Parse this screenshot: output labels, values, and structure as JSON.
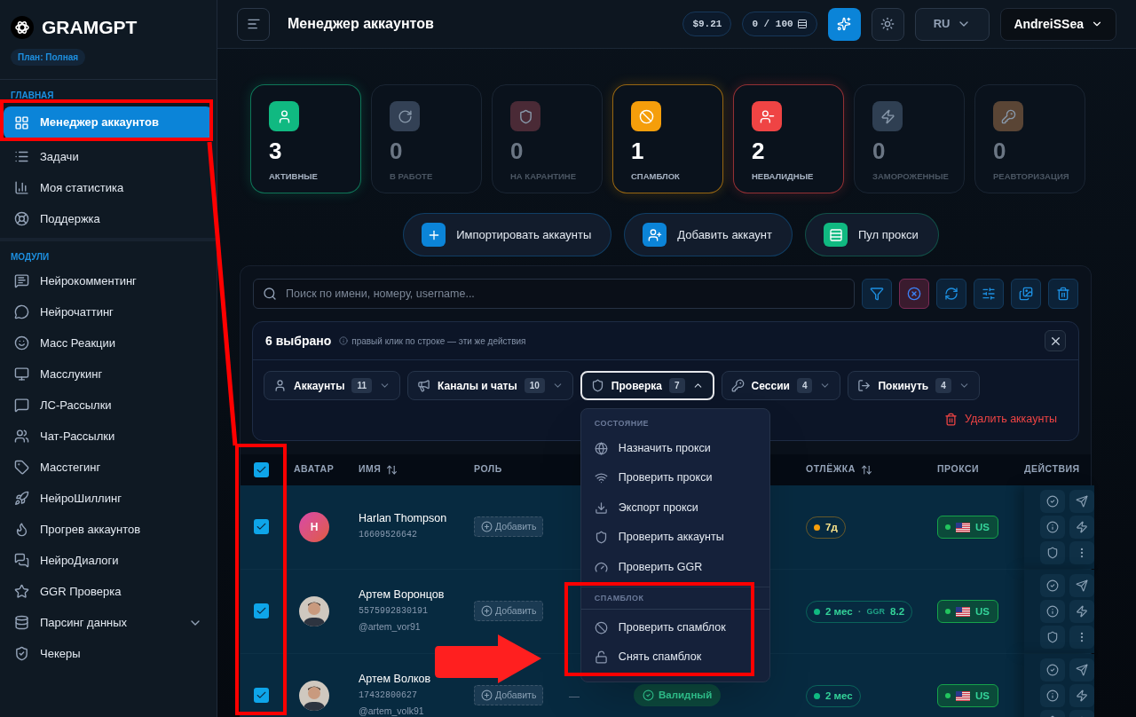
{
  "sidebar": {
    "brand": "GRAMGPT",
    "plan": "План: Полная",
    "sections": [
      {
        "title": "ГЛАВНАЯ",
        "items": [
          {
            "label": "Менеджер аккаунтов",
            "selected": true
          },
          {
            "label": "Задачи",
            "selected": false
          },
          {
            "label": "Моя статистика",
            "selected": false
          },
          {
            "label": "Поддержка",
            "selected": false
          }
        ]
      },
      {
        "title": "МОДУЛИ",
        "items": [
          {
            "label": "Нейрокомментинг",
            "selected": false
          },
          {
            "label": "Нейрочаттинг",
            "selected": false
          },
          {
            "label": "Масс Реакции",
            "selected": false
          },
          {
            "label": "Масслукинг",
            "selected": false
          },
          {
            "label": "ЛС-Рассылки",
            "selected": false
          },
          {
            "label": "Чат-Рассылки",
            "selected": false
          },
          {
            "label": "Масстегинг",
            "selected": false
          },
          {
            "label": "НейроШиллинг",
            "selected": false
          },
          {
            "label": "Прогрев аккаунтов",
            "selected": false
          },
          {
            "label": "НейроДиалоги",
            "selected": false
          },
          {
            "label": "GGR Проверка",
            "selected": false
          },
          {
            "label": "Парсинг данных",
            "selected": false,
            "expanded": false
          },
          {
            "label": "Чекеры",
            "selected": false
          }
        ]
      }
    ]
  },
  "header": {
    "title": "Менеджер аккаунтов",
    "balance": "$9.21",
    "quota": "0 / 100",
    "language": "RU",
    "user": "AndreiSSea"
  },
  "stats": [
    {
      "value": "3",
      "label": "АКТИВНЫЕ",
      "color": "#10b981",
      "highlighted": true
    },
    {
      "value": "0",
      "label": "В РАБОТЕ",
      "color": "#334155",
      "highlighted": false
    },
    {
      "value": "0",
      "label": "НА КАРАНТИНЕ",
      "color": "#4a2a36",
      "highlighted": false
    },
    {
      "value": "1",
      "label": "СПАМБЛОК",
      "color": "#f59e0b",
      "highlighted": true
    },
    {
      "value": "2",
      "label": "НЕВАЛИДНЫЕ",
      "color": "#ef4444",
      "highlighted": true
    },
    {
      "value": "0",
      "label": "ЗАМОРОЖЕННЫЕ",
      "color": "#2f3f52",
      "highlighted": false
    },
    {
      "value": "0",
      "label": "РЕАВТОРИЗАЦИЯ",
      "color": "#5a4535",
      "highlighted": false
    }
  ],
  "actions": [
    {
      "label": "Импортировать аккаунты",
      "color": "#0b84d8"
    },
    {
      "label": "Добавить аккаунт",
      "color": "#0b84d8"
    },
    {
      "label": "Пул прокси",
      "color": "#10b981"
    }
  ],
  "search": {
    "placeholder": "Поиск по имени, номеру, username..."
  },
  "selection": {
    "count": "6 выбрано",
    "hint": "правый клик по строке — эти же действия",
    "groups": [
      {
        "label": "Аккаунты",
        "count": "11",
        "expanded": false
      },
      {
        "label": "Каналы и чаты",
        "count": "10",
        "expanded": false
      },
      {
        "label": "Проверка",
        "count": "7",
        "expanded": true
      },
      {
        "label": "Сессии",
        "count": "4",
        "expanded": false
      },
      {
        "label": "Покинуть",
        "count": "4",
        "expanded": false
      }
    ],
    "delete": "Удалить аккаунты"
  },
  "menu": {
    "sections": [
      {
        "title": "СОСТОЯНИЕ",
        "items": [
          "Назначить прокси",
          "Проверить прокси",
          "Экспорт прокси",
          "Проверить аккаунты",
          "Проверить GGR"
        ]
      },
      {
        "title": "СПАМБЛОК",
        "items": [
          "Проверить спамблок",
          "Снять спамблок"
        ]
      }
    ]
  },
  "table": {
    "all_selected": true,
    "columns": [
      {
        "label": "АВАТАР",
        "sortable": false
      },
      {
        "label": "ИМЯ",
        "sortable": true
      },
      {
        "label": "РОЛЬ",
        "sortable": false
      },
      {
        "label": "ОТЛЁЖКА",
        "sortable": true
      },
      {
        "label": "ПРОКСИ",
        "sortable": false
      },
      {
        "label": "ДЕЙСТВИЯ",
        "sortable": false
      }
    ],
    "rows": [
      {
        "selected": true,
        "avatar": {
          "kind": "initial",
          "text": "H"
        },
        "name": "Harlan Thompson",
        "phone": "16609526642",
        "role": "Добавить",
        "age": {
          "text": "7д",
          "color": "#f59e0b"
        },
        "proxy": {
          "country": "US",
          "online": true
        }
      },
      {
        "selected": true,
        "avatar": {
          "kind": "photo"
        },
        "name": "Артем Воронцов",
        "phone": "5575992830191",
        "username": "@artem_vor91",
        "role": "Добавить",
        "age": {
          "text": "2 мес",
          "color": "#10b981",
          "separator": "·",
          "ggr_label": "GGR",
          "ggr": "8.2"
        },
        "proxy": {
          "country": "US",
          "online": true
        }
      },
      {
        "selected": true,
        "avatar": {
          "kind": "photo"
        },
        "name": "Артем Волков",
        "phone": "17432800627",
        "username": "@artem_volk91",
        "role": "Добавить",
        "project": "—",
        "status": "Валидный",
        "age": {
          "text": "2 мес",
          "color": "#10b981"
        },
        "proxy": {
          "country": "US",
          "online": true
        }
      }
    ]
  }
}
